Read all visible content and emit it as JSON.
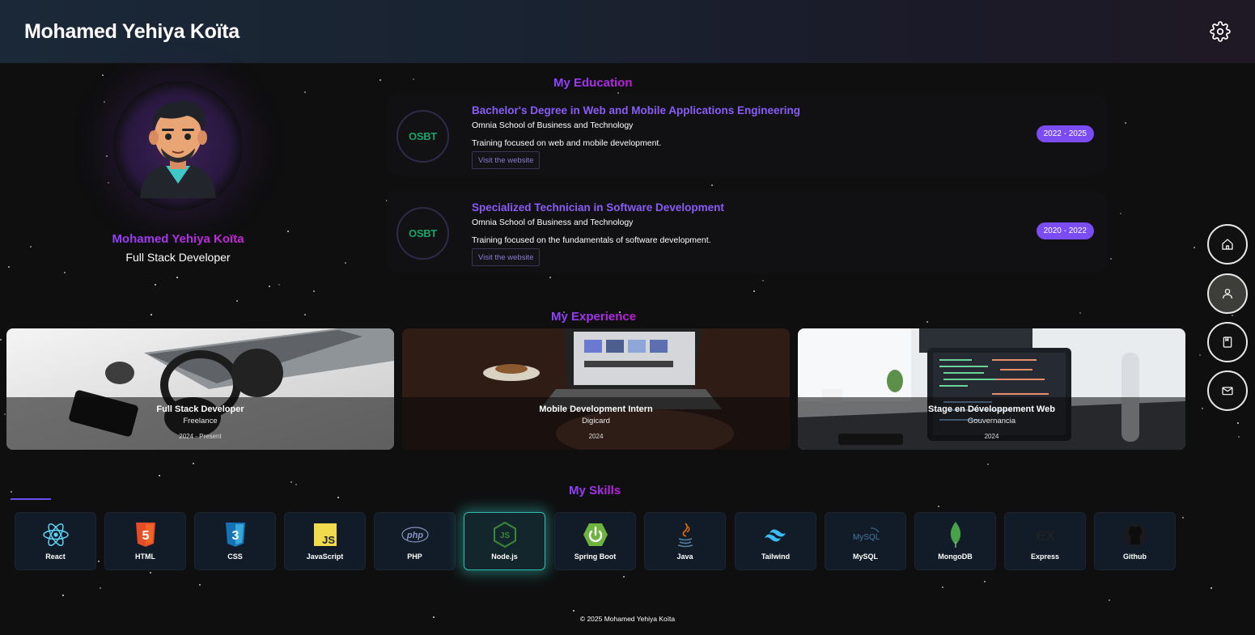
{
  "header": {
    "title": "Mohamed Yehiya Koïta"
  },
  "profile": {
    "name": "Mohamed Yehiya Koïta",
    "role": "Full Stack Developer"
  },
  "education": {
    "title": "My Education",
    "items": [
      {
        "degree": "Bachelor's Degree in Web and Mobile Applications Engineering",
        "school": "Omnia School of Business and Technology",
        "description": "Training focused on web and mobile development.",
        "link": "Visit the website",
        "period": "2022 - 2025",
        "logo": "OSBT"
      },
      {
        "degree": "Specialized Technician in Software Development",
        "school": "Omnia School of Business and Technology",
        "description": "Training focused on the fundamentals of software development.",
        "link": "Visit the website",
        "period": "2020 - 2022",
        "logo": "OSBT"
      }
    ]
  },
  "experience": {
    "title": "My Experience",
    "items": [
      {
        "title": "Full Stack Developer",
        "company": "Freelance",
        "period": "2024 - Present"
      },
      {
        "title": "Mobile Development Intern",
        "company": "Digicard",
        "period": "2024"
      },
      {
        "title": "Stage en Développement Web",
        "company": "Gouvernancia",
        "period": "2024"
      }
    ]
  },
  "skills": {
    "title": "My Skills",
    "items": [
      {
        "label": "React",
        "icon": "react-icon"
      },
      {
        "label": "HTML",
        "icon": "html5-icon",
        "glyph": "5"
      },
      {
        "label": "CSS",
        "icon": "css3-icon",
        "glyph": "3"
      },
      {
        "label": "JavaScript",
        "icon": "javascript-icon",
        "glyph": "JS"
      },
      {
        "label": "PHP",
        "icon": "php-icon",
        "glyph": "php"
      },
      {
        "label": "Node.js",
        "icon": "nodejs-icon",
        "glyph": "JS"
      },
      {
        "label": "Spring Boot",
        "icon": "spring-boot-icon"
      },
      {
        "label": "Java",
        "icon": "java-icon"
      },
      {
        "label": "Tailwind",
        "icon": "tailwind-icon"
      },
      {
        "label": "MySQL",
        "icon": "mysql-icon",
        "glyph": "MySQL"
      },
      {
        "label": "MongoDB",
        "icon": "mongodb-icon"
      },
      {
        "label": "Express",
        "icon": "express-icon",
        "glyph": "ex"
      },
      {
        "label": "Github",
        "icon": "github-icon"
      }
    ]
  },
  "footer": {
    "text": "© 2025 Mohamed Yehiya Koïta"
  },
  "colors": {
    "accent": "#7b4cf1",
    "pink": "#d21fd0",
    "background": "#0f0f10"
  }
}
